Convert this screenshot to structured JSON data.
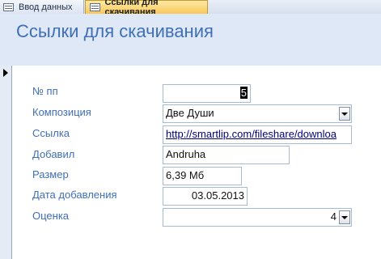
{
  "tabs": [
    {
      "label": "Ввод данных",
      "active": false,
      "icon": "form-icon"
    },
    {
      "label": "Ссылки для скачивания",
      "active": true,
      "icon": "form-icon"
    }
  ],
  "form": {
    "title": "Ссылки для скачивания",
    "fields": {
      "number": {
        "label": "№ пп",
        "value": "5"
      },
      "composition": {
        "label": "Композиция",
        "value": "Две Души"
      },
      "link": {
        "label": "Ссылка",
        "value": "http://smartlip.com/fileshare/downloa"
      },
      "added_by": {
        "label": "Добавил",
        "value": "Andruha"
      },
      "size": {
        "label": "Размер",
        "value": "6,39 Мб"
      },
      "date_added": {
        "label": "Дата добавления",
        "value": "03.05.2013"
      },
      "rating": {
        "label": "Оценка",
        "value": "4"
      }
    }
  },
  "colors": {
    "accent": "#3f6fb5",
    "header_bg": "#dfe8f6",
    "active_tab": "#f8c75c",
    "field_border": "#a7bad6"
  }
}
